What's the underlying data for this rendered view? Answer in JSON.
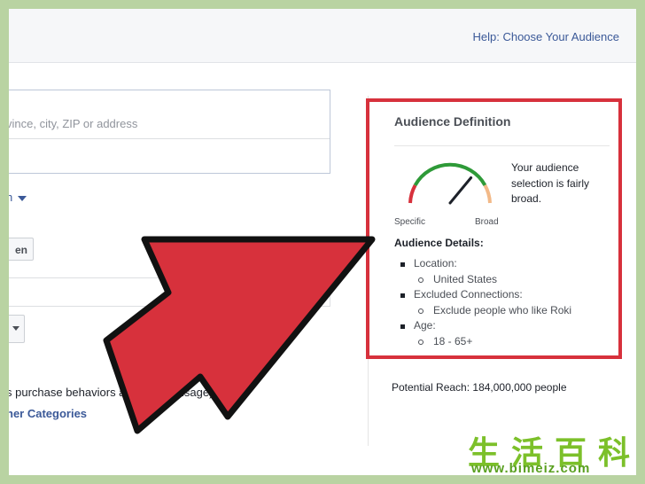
{
  "header": {
    "help_link": "Help: Choose Your Audience"
  },
  "left": {
    "location_placeholder": "vince, city, ZIP or address",
    "dropdown_label": "n",
    "button_label": "en",
    "behaviors_text": "s purchase behaviors and device usage)",
    "more_link": "ner Categories"
  },
  "audience": {
    "title": "Audience Definition",
    "gauge": {
      "min_label": "Specific",
      "max_label": "Broad",
      "level": 0.72
    },
    "description": "Your audience selection is fairly broad.",
    "details_title": "Audience Details:",
    "details": [
      {
        "label": "Location:",
        "value": "United States"
      },
      {
        "label": "Excluded Connections:",
        "value": "Exclude people who like Roki"
      },
      {
        "label": "Age:",
        "value": "18 - 65+"
      }
    ],
    "potential_reach": "Potential Reach: 184,000,000 people"
  },
  "colors": {
    "highlight_border": "#d7313c",
    "arrow_fill": "#d7313c",
    "gauge_green": "#2e9a38",
    "gauge_red": "#d7313c",
    "gauge_orange": "#f2b988",
    "link_blue": "#3b5998"
  },
  "watermark": {
    "chars": "生活百科",
    "url": "www.bimeiz.com"
  }
}
